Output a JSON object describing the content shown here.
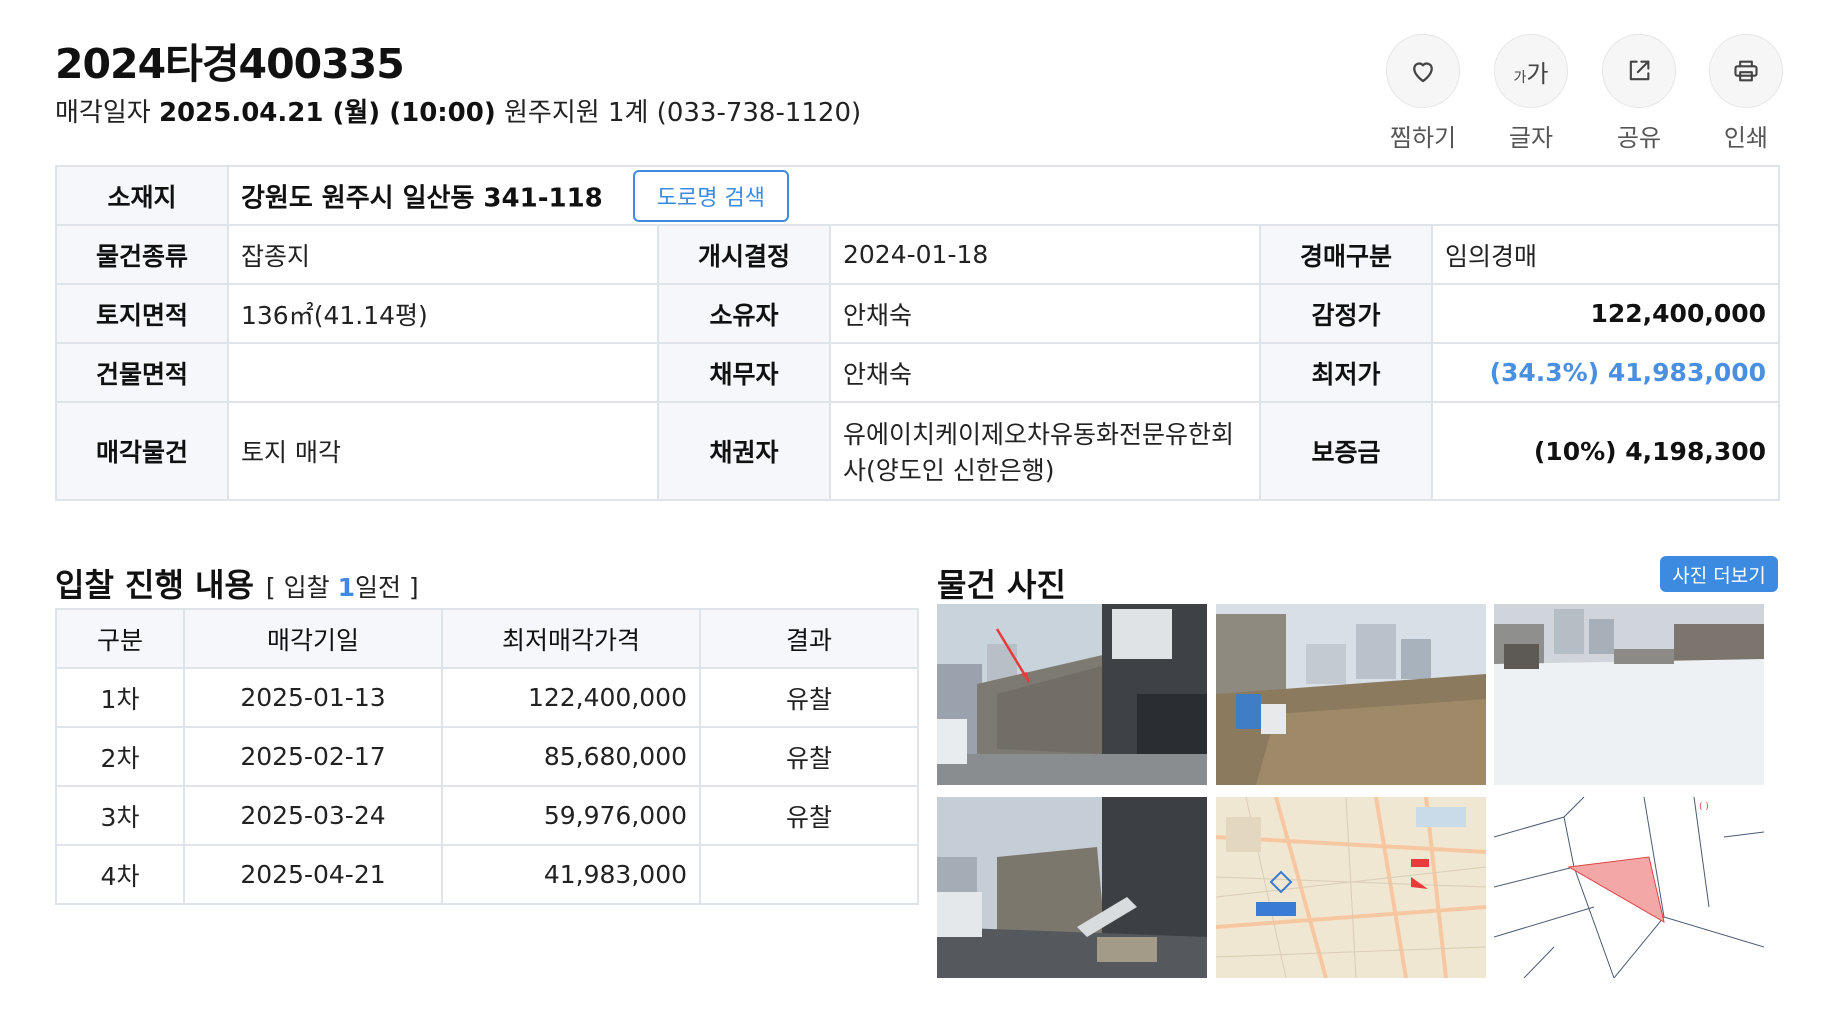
{
  "header": {
    "case_no": "2024타경400335",
    "date_label": "매각일자",
    "date_value": "2025.04.21 (월) (10:00)",
    "court": "원주지원 1계 (033-738-1120)"
  },
  "actions": [
    {
      "label": "찜하기",
      "icon": "heart-icon"
    },
    {
      "label": "글자",
      "icon": "font-size-icon",
      "glyph_small": "가",
      "glyph_big": "가"
    },
    {
      "label": "공유",
      "icon": "share-icon"
    },
    {
      "label": "인쇄",
      "icon": "print-icon"
    }
  ],
  "info": {
    "location_label": "소재지",
    "location_value": "강원도 원주시 일산동 341-118",
    "road_search": "도로명 검색",
    "rows": [
      [
        {
          "k": "물건종류",
          "v": "잡종지"
        },
        {
          "k": "개시결정",
          "v": "2024-01-18"
        },
        {
          "k": "경매구분",
          "v": "임의경매"
        }
      ],
      [
        {
          "k": "토지면적",
          "v": "136㎡(41.14평)"
        },
        {
          "k": "소유자",
          "v": "안채숙"
        },
        {
          "k": "감정가",
          "v": "122,400,000"
        }
      ],
      [
        {
          "k": "건물면적",
          "v": ""
        },
        {
          "k": "채무자",
          "v": "안채숙"
        },
        {
          "k": "최저가",
          "v": "(34.3%) 41,983,000"
        }
      ],
      [
        {
          "k": "매각물건",
          "v": "토지 매각"
        },
        {
          "k": "채권자",
          "v": "유에이치케이제오차유동화전문유한회사(양도인 신한은행)"
        },
        {
          "k": "보증금",
          "v": "(10%) 4,198,300"
        }
      ]
    ]
  },
  "bidding": {
    "title": "입찰 진행 내용",
    "sub_open": "[ 입찰 ",
    "sub_num": "1",
    "sub_close": "일전 ]",
    "headers": [
      "구분",
      "매각기일",
      "최저매각가격",
      "결과"
    ],
    "rows": [
      {
        "round": "1차",
        "date": "2025-01-13",
        "price": "122,400,000",
        "result": "유찰"
      },
      {
        "round": "2차",
        "date": "2025-02-17",
        "price": "85,680,000",
        "result": "유찰"
      },
      {
        "round": "3차",
        "date": "2025-03-24",
        "price": "59,976,000",
        "result": "유찰"
      },
      {
        "round": "4차",
        "date": "2025-04-21",
        "price": "41,983,000",
        "result": ""
      }
    ]
  },
  "photos": {
    "title": "물건 사진",
    "more": "사진 더보기"
  },
  "colors": {
    "accent": "#3c8be0",
    "low_price": "#4a90e2",
    "header_bg": "#f5f7fb",
    "border": "#dfe3ea"
  }
}
